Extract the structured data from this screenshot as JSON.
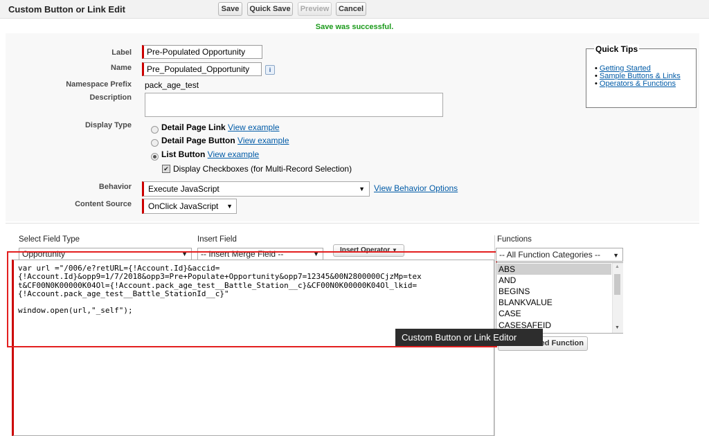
{
  "header": {
    "title": "Custom Button or Link Edit",
    "buttons": {
      "save": "Save",
      "quick_save": "Quick Save",
      "preview": "Preview",
      "cancel": "Cancel"
    }
  },
  "status": {
    "message": "Save was successful.",
    "color": "#1a9a1a"
  },
  "form": {
    "label": {
      "caption": "Label",
      "value": "Pre-Populated Opportunity"
    },
    "name": {
      "caption": "Name",
      "value": "Pre_Populated_Opportunity",
      "info_icon": "info-icon"
    },
    "namespace_prefix": {
      "caption": "Namespace Prefix",
      "value": "pack_age_test"
    },
    "description": {
      "caption": "Description",
      "value": ""
    },
    "display_type": {
      "caption": "Display Type",
      "options": [
        {
          "label": "Detail Page Link",
          "link": "View example",
          "selected": false
        },
        {
          "label": "Detail Page Button",
          "link": "View example",
          "selected": false
        },
        {
          "label": "List Button",
          "link": "View example",
          "selected": true
        }
      ],
      "checkbox_label": "Display Checkboxes (for Multi-Record Selection)",
      "checkbox_checked": true
    },
    "behavior": {
      "caption": "Behavior",
      "value": "Execute JavaScript",
      "link": "View Behavior Options"
    },
    "content_source": {
      "caption": "Content Source",
      "value": "OnClick JavaScript"
    }
  },
  "quick_tips": {
    "title": "Quick Tips",
    "links": [
      "Getting Started",
      "Sample Buttons & Links",
      "Operators & Functions"
    ]
  },
  "editor": {
    "select_field_type_label": "Select Field Type",
    "select_field_type_value": "Opportunity",
    "insert_field_label": "Insert Field",
    "insert_field_value": "-- Insert Merge Field --",
    "insert_operator_label": "Insert Operator",
    "code_lines": [
      "var url =\"/006/e?retURL={!Account.Id}&accid=",
      "{!Account.Id}&opp9=1/7/2018&opp3=Pre+Populate+Opportunity&opp7=12345&00N2800000CjzMp=tex",
      "t&CF00N0K00000K04Ol={!Account.pack_age_test__Battle_Station__c}&CF00N0K00000K04Ol_lkid=",
      "{!Account.pack_age_test__Battle_StationId__c}\"",
      "",
      "window.open(url,\"_self\");"
    ],
    "tooltip": "Custom Button or Link Editor"
  },
  "functions": {
    "label": "Functions",
    "category_value": "-- All Function Categories --",
    "items": [
      "ABS",
      "AND",
      "BEGINS",
      "BLANKVALUE",
      "CASE",
      "CASESAFEID"
    ],
    "selected_index": 0,
    "insert_button": "Insert Selected Function",
    "insert_button_visible": "ted Function"
  },
  "accent_colors": {
    "required": "#cc0000",
    "highlight_box": "#e31e1e",
    "link": "#015ba7"
  }
}
